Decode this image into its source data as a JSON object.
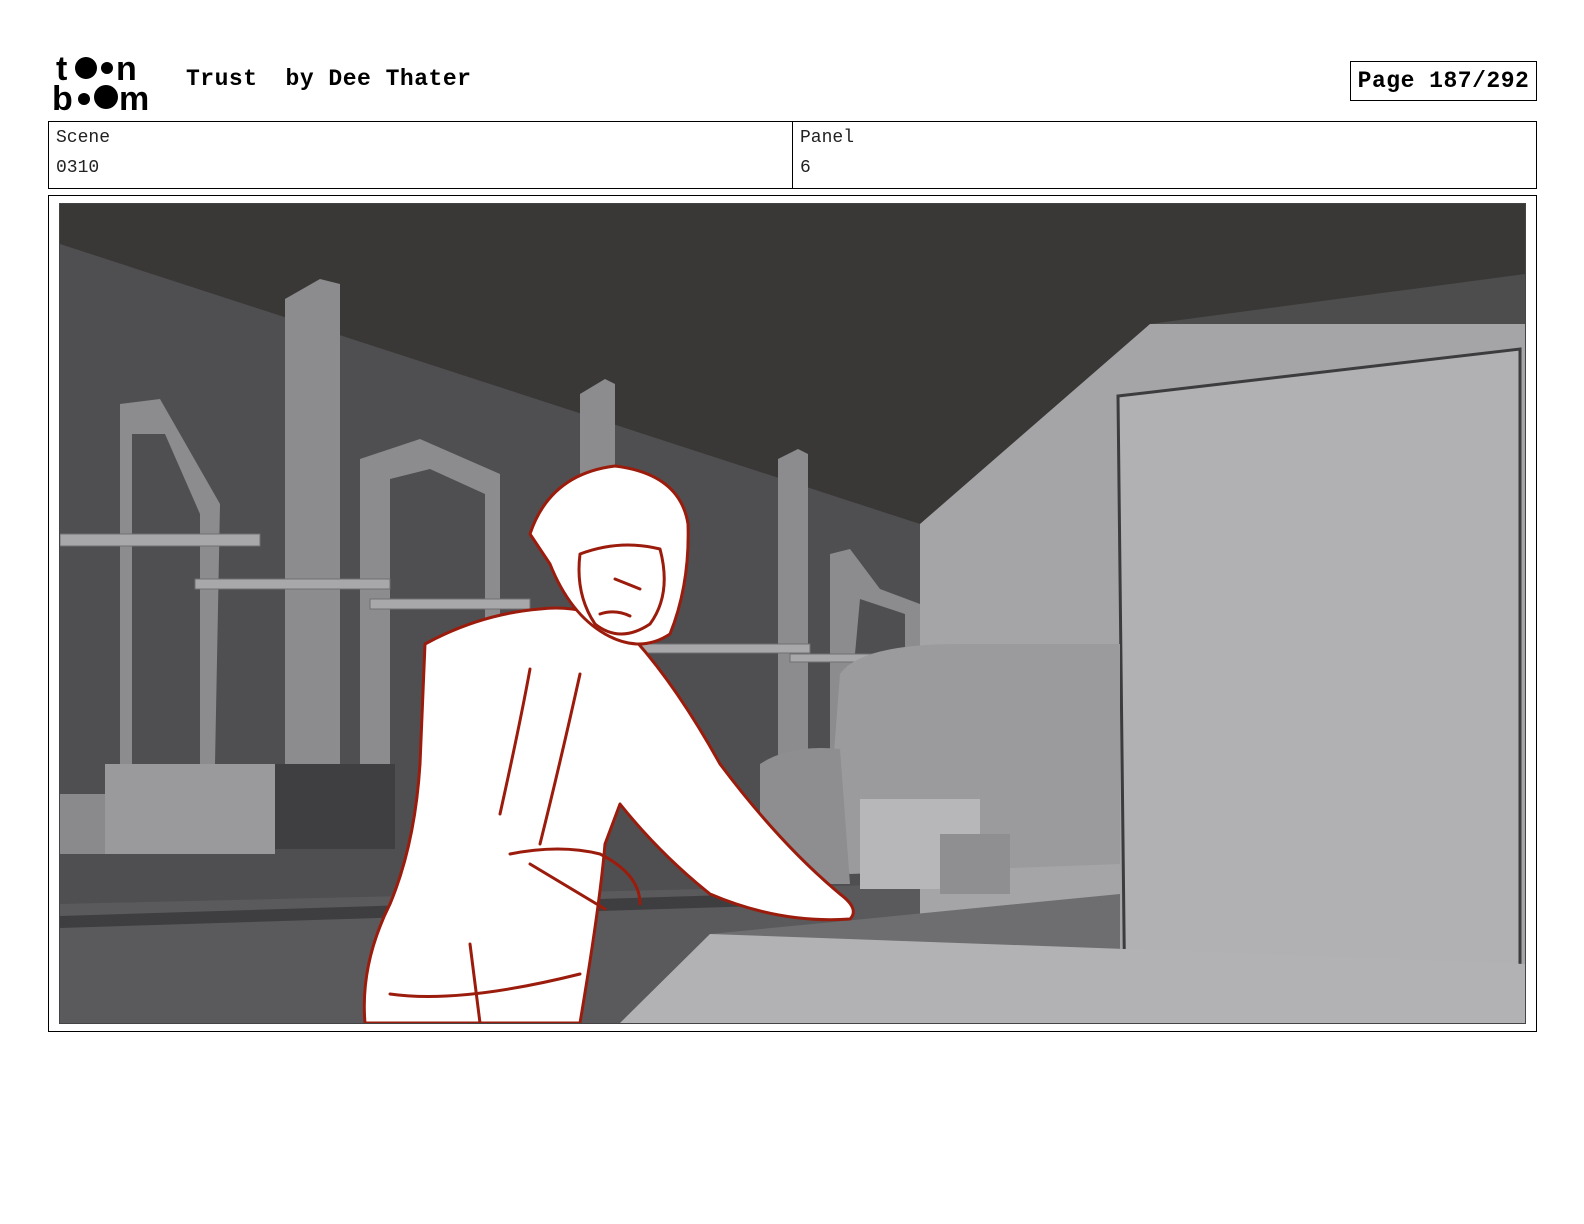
{
  "header": {
    "logo_text": "toon boom",
    "title": "Trust",
    "author": "by Dee Thater",
    "page_label": "Page 187/292"
  },
  "info": {
    "scene_label": "Scene",
    "scene_value": "0310",
    "panel_label": "Panel",
    "panel_value": "6"
  },
  "panel": {
    "image_description_name": "storyboard-panel-image",
    "sketch_color": "#9b1c0c"
  }
}
